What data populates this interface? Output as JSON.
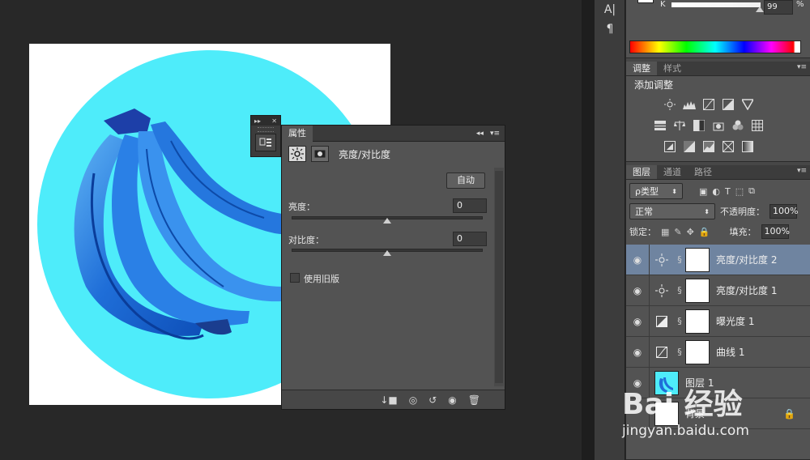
{
  "properties_panel": {
    "tab_label": "属性",
    "collapse_glyph": "◂◂",
    "menu_glyph": "▾≡",
    "title": "亮度/对比度",
    "auto_button": "自动",
    "brightness_label": "亮度：",
    "brightness_value": "0",
    "contrast_label": "对比度：",
    "contrast_value": "0",
    "legacy_label": "使用旧版"
  },
  "mini_dock": {
    "expand_glyph": "▸▸",
    "close_glyph": "✕"
  },
  "tool_strip": {
    "text_tool": "A|",
    "paragraph_tool": "¶"
  },
  "color_panel": {
    "channel_label": "K",
    "value": "99",
    "unit": "%"
  },
  "adjustments_panel": {
    "tabs": [
      "调整",
      "样式"
    ],
    "heading": "添加调整",
    "icons_row1": [
      "brightness-icon",
      "levels-icon",
      "curves-icon",
      "exposure-icon",
      "vibrance-icon"
    ],
    "icons_row2": [
      "hue-sat-icon",
      "color-balance-icon",
      "black-white-icon",
      "photo-filter-icon",
      "channel-mixer-icon",
      "color-lookup-icon"
    ],
    "icons_row3": [
      "invert-icon",
      "posterize-icon",
      "threshold-icon",
      "selective-color-icon",
      "gradient-map-icon"
    ]
  },
  "layers_panel": {
    "tabs": [
      "图层",
      "通道",
      "路径"
    ],
    "filter_label": "ρ类型",
    "blend_mode": "正常",
    "opacity_label": "不透明度：",
    "opacity_value": "100%",
    "lock_label": "锁定：",
    "fill_label": "填充：",
    "fill_value": "100%",
    "layers": [
      {
        "name": "亮度/对比度 2",
        "selected": true,
        "icon": "brightness-icon"
      },
      {
        "name": "亮度/对比度 1",
        "selected": false,
        "icon": "brightness-icon"
      },
      {
        "name": "曝光度 1",
        "selected": false,
        "icon": "exposure-icon"
      },
      {
        "name": "曲线 1",
        "selected": false,
        "icon": "curves-icon"
      },
      {
        "name": "图层 1",
        "selected": false,
        "icon": "image-thumb"
      },
      {
        "name": "背景",
        "selected": false,
        "icon": "white-thumb"
      }
    ]
  },
  "watermark": {
    "brand": "Bai 经验",
    "url": "jingyan.baidu.com"
  },
  "colors": {
    "canvas_bg": "#ffffff",
    "circle": "#4eecfa",
    "banana": "#1a6ad8",
    "selected_layer": "#6f84a0"
  }
}
